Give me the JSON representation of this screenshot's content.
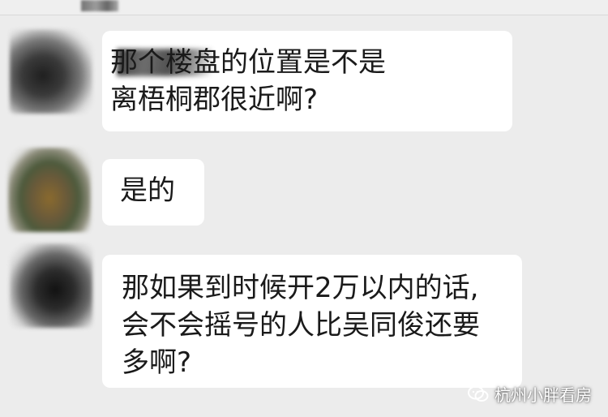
{
  "messages": [
    {
      "text": "那个楼盘的位置是不是\n离梧桐郡很近啊?"
    },
    {
      "text": "是的"
    },
    {
      "text": "那如果到时候开2万以内的话,\n会不会摇号的人比吴同俊还要\n多啊?"
    }
  ],
  "watermark": {
    "text": "杭州小胖看房",
    "icon": "wechat-icon"
  }
}
